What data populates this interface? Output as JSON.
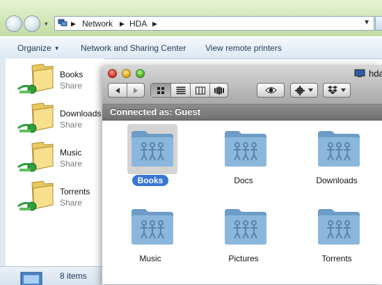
{
  "explorer": {
    "address": {
      "crumbs": [
        "Network",
        "HDA"
      ]
    },
    "toolbar": {
      "organize": "Organize",
      "network_center": "Network and Sharing Center",
      "remote_printers": "View remote printers"
    },
    "folders": [
      {
        "name": "Books",
        "type": "Share"
      },
      {
        "name": "Downloads",
        "type": "Share"
      },
      {
        "name": "Music",
        "type": "Share"
      },
      {
        "name": "Torrents",
        "type": "Share"
      }
    ],
    "status": {
      "count": "8 items"
    }
  },
  "finder": {
    "title": "hda",
    "connection": "Connected as: Guest",
    "selected": "Books",
    "folders": [
      "Books",
      "Docs",
      "Downloads",
      "Music",
      "Pictures",
      "Torrents"
    ]
  },
  "colors": {
    "selection": "#3a76d3",
    "folder_blue": "#8cb7dc",
    "share_green": "#2e9f3b"
  }
}
